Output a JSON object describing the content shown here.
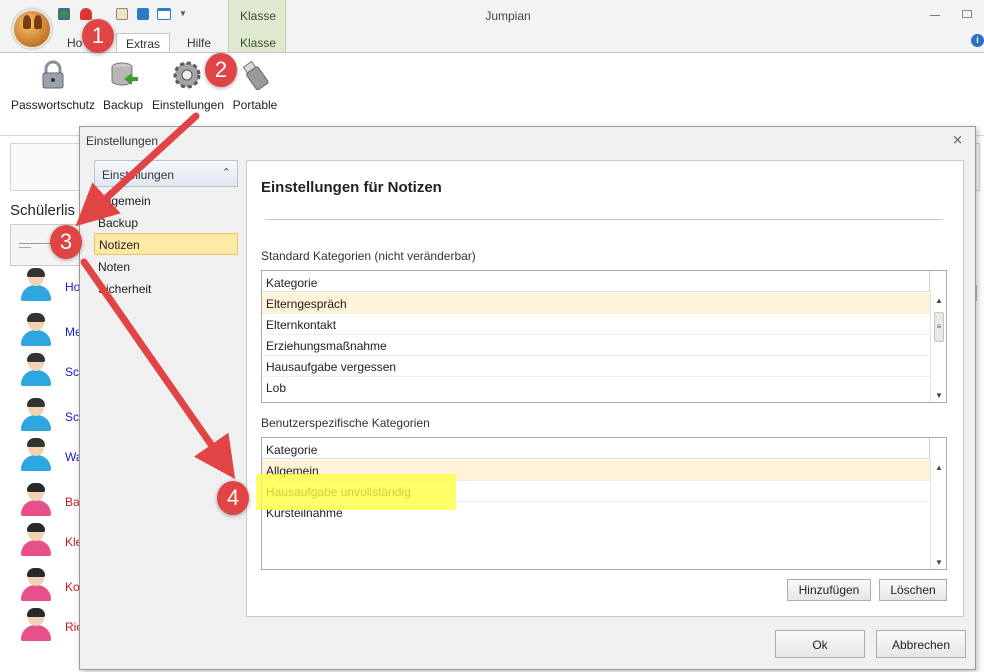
{
  "app": {
    "title": "Jumpian"
  },
  "ribbon": {
    "tabs": [
      "Ho",
      "Extras",
      "Hilfe"
    ],
    "context_group": "Klasse",
    "context_tab": "Klasse",
    "buttons": [
      "Passwortschutz",
      "Backup",
      "Einstellungen",
      "Portable"
    ]
  },
  "background": {
    "list_title": "Schülerlis",
    "students": [
      {
        "name": "Ho",
        "color": "#1a1acc",
        "gender": "m"
      },
      {
        "name": "Me",
        "color": "#1a1acc",
        "gender": "m"
      },
      {
        "name": "Sc",
        "color": "#1a1acc",
        "gender": "m"
      },
      {
        "name": "Sc",
        "color": "#1a1acc",
        "gender": "m"
      },
      {
        "name": "Wa",
        "color": "#1a1acc",
        "gender": "m"
      },
      {
        "name": "Ba",
        "color": "#cc1a1a",
        "gender": "f"
      },
      {
        "name": "Kle",
        "color": "#cc1a1a",
        "gender": "f"
      },
      {
        "name": "Ko",
        "color": "#cc1a1a",
        "gender": "f"
      },
      {
        "name": "Ric",
        "color": "#cc1a1a",
        "gender": "f"
      }
    ]
  },
  "dialog": {
    "title": "Einstellungen",
    "close": "⨯",
    "nav": {
      "header": "Einstellungen",
      "items": [
        "Allgemein",
        "Backup",
        "Notizen",
        "Noten",
        "Sicherheit"
      ],
      "selected": "Notizen"
    },
    "content": {
      "title": "Einstellungen für Notizen",
      "standard": {
        "label": "Standard Kategorien (nicht veränderbar)",
        "column": "Kategorie",
        "rows": [
          "Elterngespräch",
          "Elternkontakt",
          "Erziehungsmaßnahme",
          "Hausaufgabe vergessen",
          "Lob"
        ]
      },
      "custom": {
        "label": "Benutzerspezifische Kategorien",
        "column": "Kategorie",
        "rows": [
          "Allgemein",
          "Hausaufgabe unvollständig",
          "Kursteilnahme"
        ]
      },
      "add_button": "Hinzufügen",
      "delete_button": "Löschen"
    },
    "ok_button": "Ok",
    "cancel_button": "Abbrechen"
  },
  "annotations": {
    "steps": [
      "1",
      "2",
      "3",
      "4"
    ],
    "arrow_color": "#e04444",
    "highlight_color": "#ffff3c"
  }
}
